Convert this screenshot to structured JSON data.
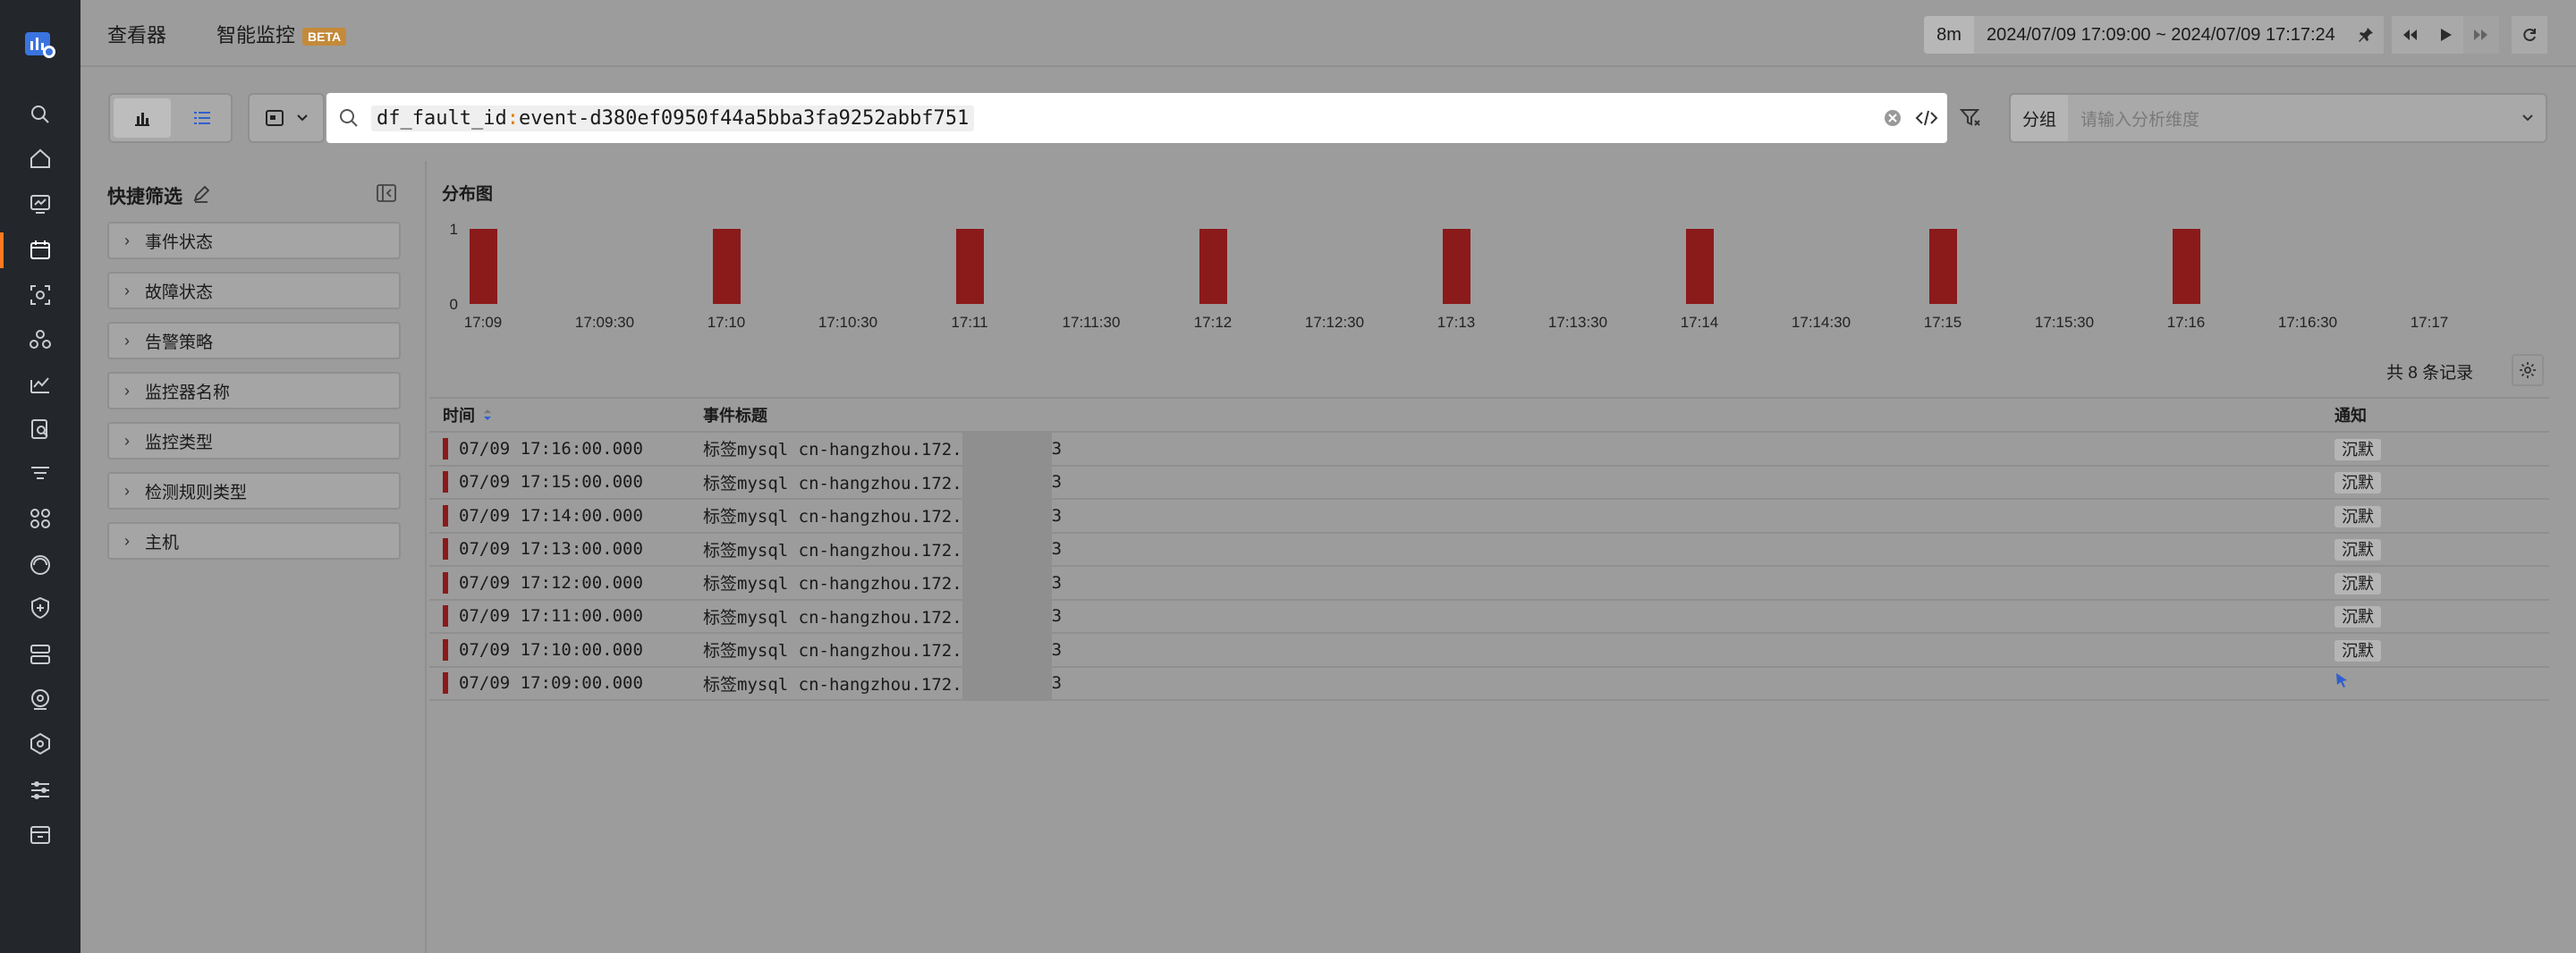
{
  "nav": {
    "items": [
      "search-icon",
      "home-icon",
      "dashboard-icon",
      "event-icon",
      "scan-icon",
      "apm-icon",
      "metrics-icon",
      "log-icon",
      "filter-icon",
      "apps-icon",
      "rum-icon",
      "security-icon",
      "infra-icon",
      "camera-icon",
      "cube-icon",
      "sliders-icon",
      "storage-icon"
    ],
    "accent": "#ff7a22"
  },
  "header": {
    "tab_viewer": "查看器",
    "tab_monitor": "智能监控",
    "beta": "BETA"
  },
  "time": {
    "duration": "8m",
    "range": "2024/07/09 17:09:00 ~ 2024/07/09 17:17:24"
  },
  "search": {
    "key": "df_fault_id",
    "sep": ":",
    "value": "event-d380ef0950f44a5bba3fa9252abbf751"
  },
  "group": {
    "label": "分组",
    "placeholder": "请输入分析维度"
  },
  "quick_filter": {
    "title": "快捷筛选",
    "items": [
      "事件状态",
      "故障状态",
      "告警策略",
      "监控器名称",
      "监控类型",
      "检测规则类型",
      "主机"
    ]
  },
  "chart_data": {
    "type": "bar",
    "title": "分布图",
    "x": [
      "17:09",
      "17:10",
      "17:11",
      "17:12",
      "17:13",
      "17:14",
      "17:15",
      "17:16"
    ],
    "values": [
      1,
      1,
      1,
      1,
      1,
      1,
      1,
      1
    ],
    "x_tick_labels": [
      "17:09",
      "17:09:30",
      "17:10",
      "17:10:30",
      "17:11",
      "17:11:30",
      "17:12",
      "17:12:30",
      "17:13",
      "17:13:30",
      "17:14",
      "17:14:30",
      "17:15",
      "17:15:30",
      "17:16",
      "17:16:30",
      "17:17"
    ],
    "y_tick_labels": [
      "1",
      "0"
    ],
    "ylim": [
      0,
      1
    ],
    "bar_color": "#8b1a1a"
  },
  "table": {
    "count": "共 8 条记录",
    "headers": {
      "time": "时间",
      "title": "事件标题",
      "notify": "通知"
    },
    "rows": [
      {
        "time": "07/09 17:16:00.000",
        "title_prefix": "标签mysql cn-hangzhou.172.",
        "title_suffix": "3",
        "notify": "沉默"
      },
      {
        "time": "07/09 17:15:00.000",
        "title_prefix": "标签mysql cn-hangzhou.172.",
        "title_suffix": "3",
        "notify": "沉默"
      },
      {
        "time": "07/09 17:14:00.000",
        "title_prefix": "标签mysql cn-hangzhou.172.",
        "title_suffix": "3",
        "notify": "沉默"
      },
      {
        "time": "07/09 17:13:00.000",
        "title_prefix": "标签mysql cn-hangzhou.172.",
        "title_suffix": "3",
        "notify": "沉默"
      },
      {
        "time": "07/09 17:12:00.000",
        "title_prefix": "标签mysql cn-hangzhou.172.",
        "title_suffix": "3",
        "notify": "沉默"
      },
      {
        "time": "07/09 17:11:00.000",
        "title_prefix": "标签mysql cn-hangzhou.172.",
        "title_suffix": "3",
        "notify": "沉默"
      },
      {
        "time": "07/09 17:10:00.000",
        "title_prefix": "标签mysql cn-hangzhou.172.",
        "title_suffix": "3",
        "notify": "沉默"
      },
      {
        "time": "07/09 17:09:00.000",
        "title_prefix": "标签mysql cn-hangzhou.172.",
        "title_suffix": "3",
        "notify": ""
      }
    ]
  }
}
